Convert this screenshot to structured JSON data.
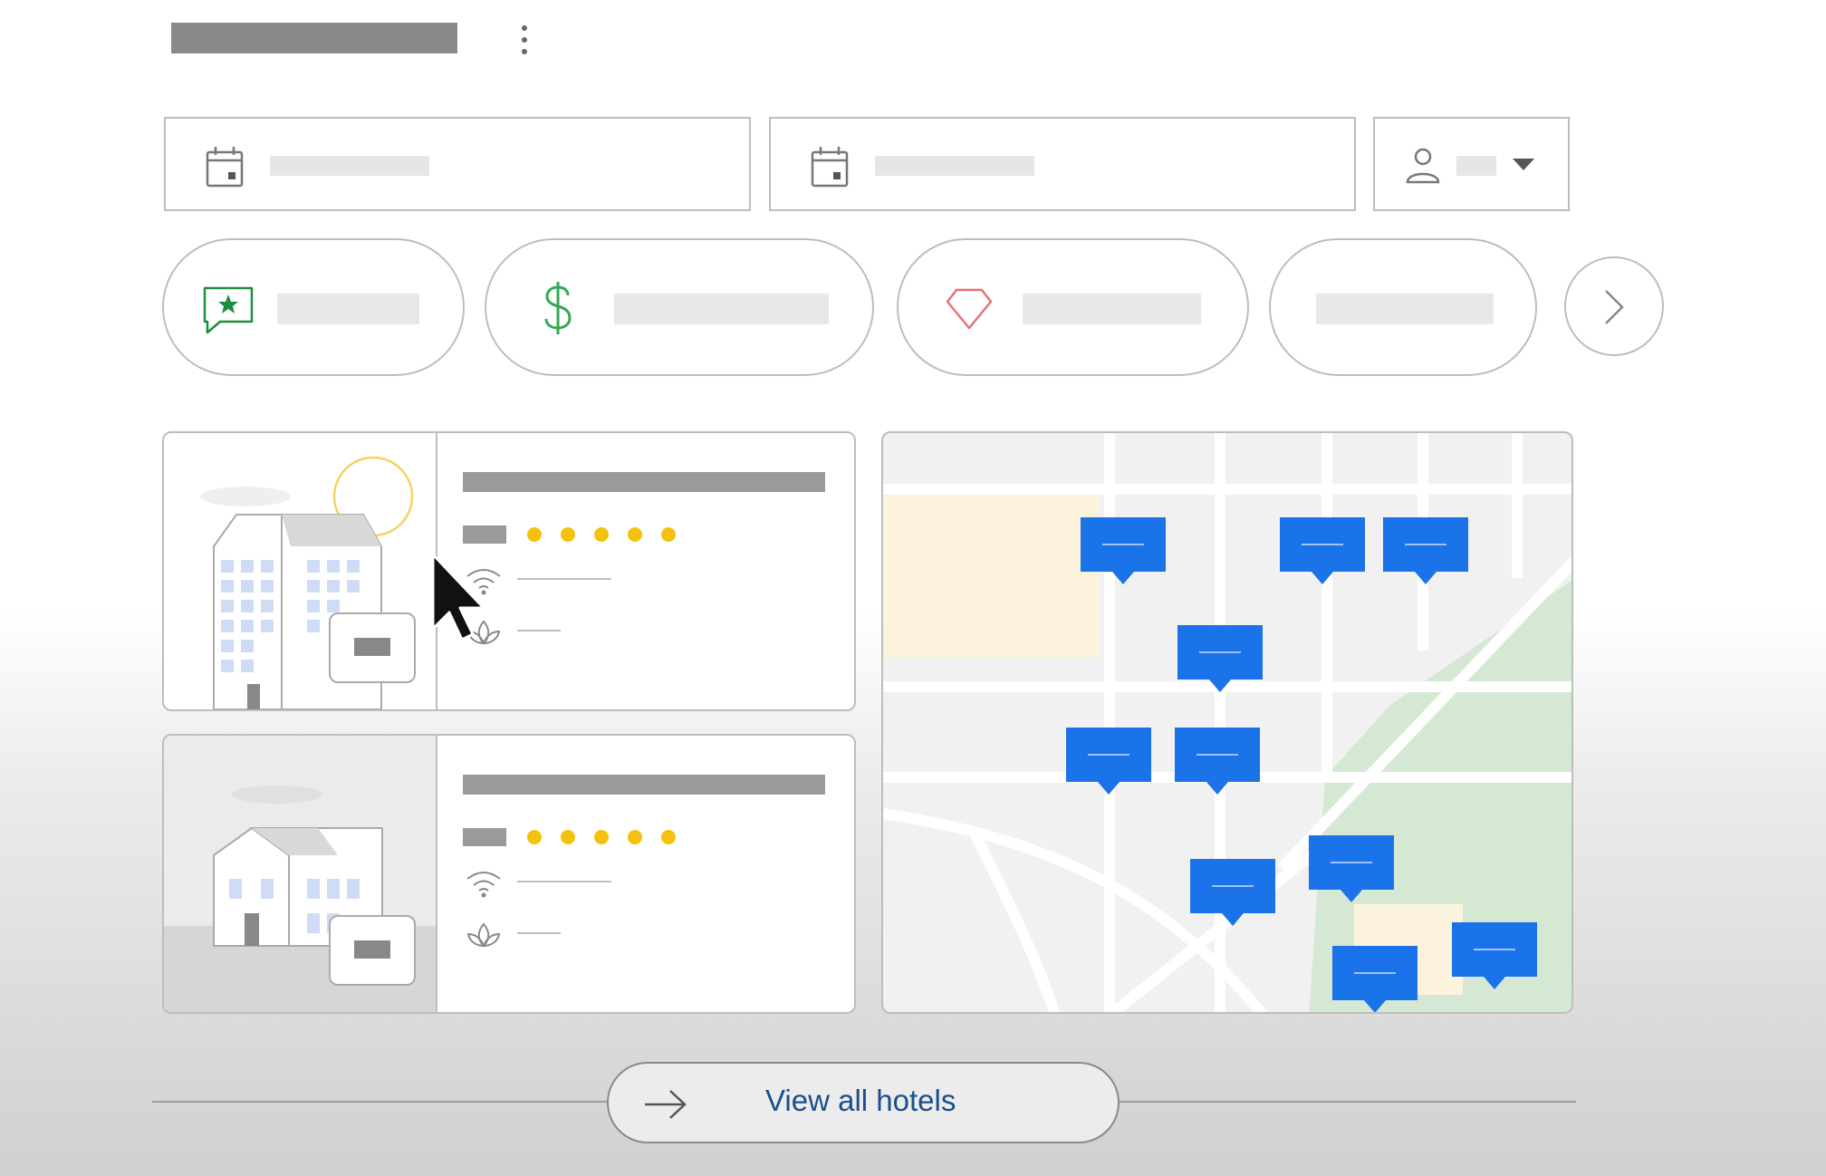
{
  "cta": {
    "label": "View all hotels"
  },
  "hotels": [
    {
      "rating_dots": 5
    },
    {
      "rating_dots": 5
    }
  ],
  "map": {
    "pin_count": 10
  },
  "colors": {
    "accent_blue": "#1a73e8",
    "star_yellow": "#f4c20d",
    "reviews_green": "#1e8e3e",
    "price_green": "#34a853",
    "diamond_red": "#e57373",
    "park_green": "#d5e8d4",
    "block_yellow": "#fbf3dc"
  },
  "icons": {
    "date": "calendar-icon",
    "guests": "person-icon",
    "reviews": "review-star-icon",
    "price": "dollar-icon",
    "luxury": "diamond-icon",
    "next": "chevron-right-icon",
    "wifi": "wifi-icon",
    "spa": "lotus-icon",
    "cta": "arrow-right-icon"
  }
}
